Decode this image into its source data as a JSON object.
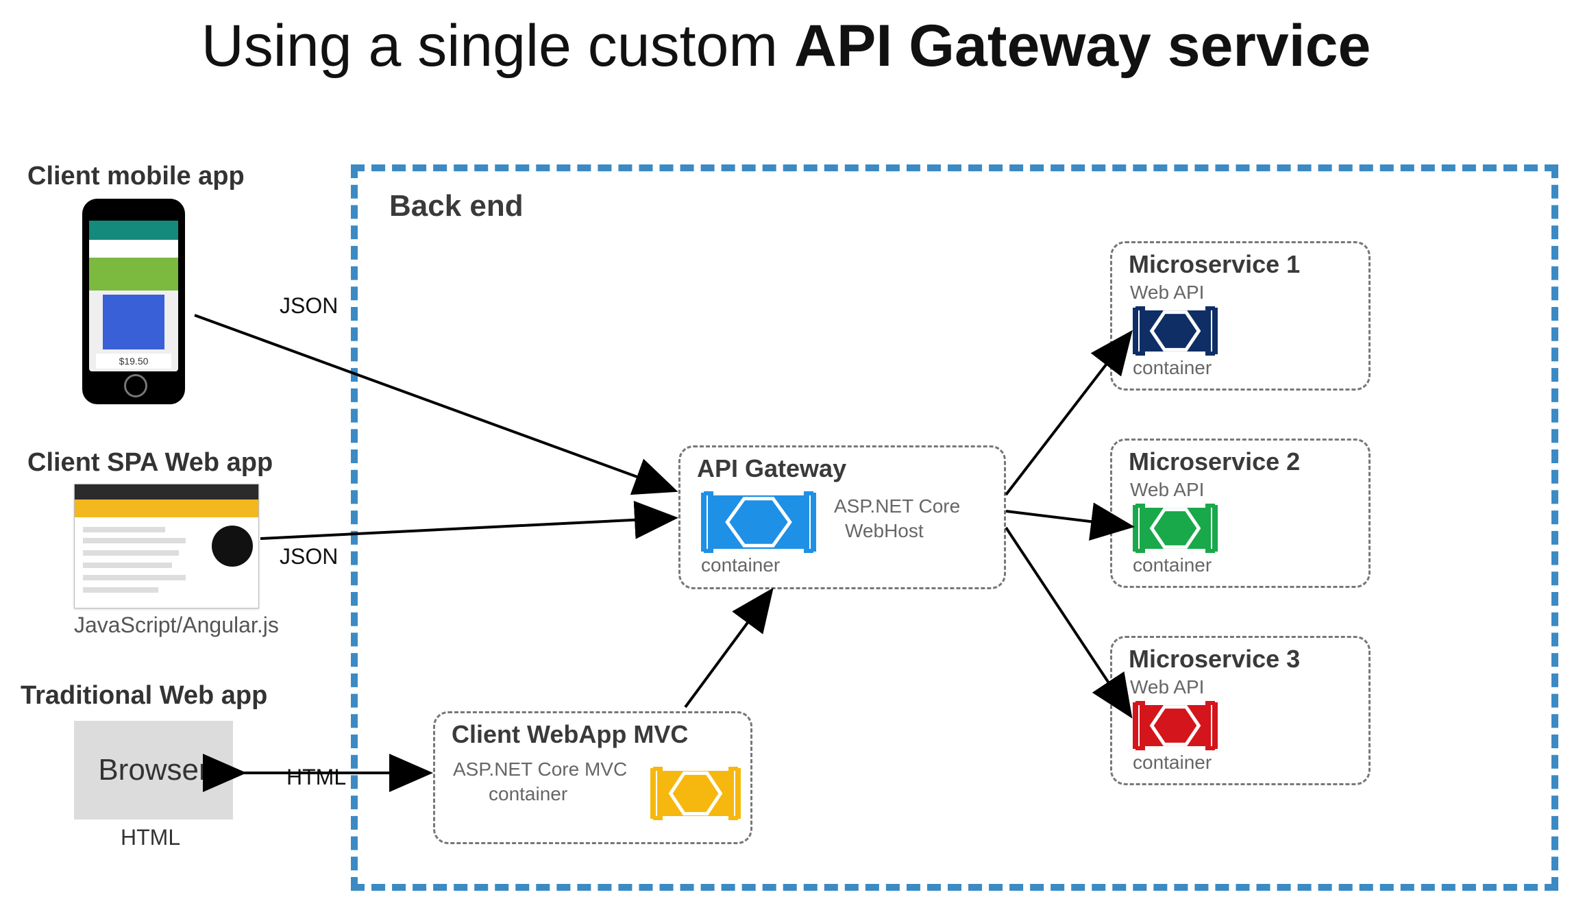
{
  "title_prefix": "Using a single custom ",
  "title_bold": "API Gateway service",
  "backend_label": "Back end",
  "clients": {
    "mobile": {
      "label": "Client mobile app",
      "price": "$19.50",
      "edge": "JSON"
    },
    "spa": {
      "label": "Client SPA Web app",
      "caption": "JavaScript/Angular.js",
      "edge": "JSON"
    },
    "trad": {
      "label": "Traditional Web app",
      "tile": "Browser",
      "caption": "HTML",
      "edge": "HTML"
    }
  },
  "mvc": {
    "title": "Client WebApp MVC",
    "line1": "ASP.NET Core MVC",
    "line2": "container",
    "color": "#f6b80f"
  },
  "gateway": {
    "title": "API Gateway",
    "line1": "ASP.NET Core",
    "line2": "WebHost",
    "footer": "container",
    "color": "#1e90e6"
  },
  "microservices": [
    {
      "title": "Microservice 1",
      "api": "Web API",
      "footer": "container",
      "color": "#0f2e66"
    },
    {
      "title": "Microservice 2",
      "api": "Web API",
      "footer": "container",
      "color": "#19a84a"
    },
    {
      "title": "Microservice 3",
      "api": "Web API",
      "footer": "container",
      "color": "#d4151b"
    }
  ]
}
